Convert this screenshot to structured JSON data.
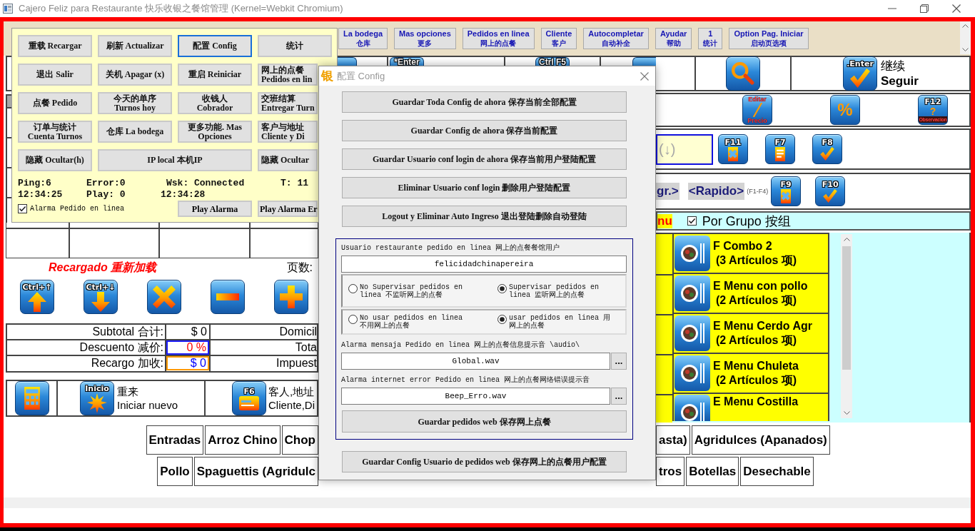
{
  "window": {
    "title": "Cajero Feliz para Restaurante 快乐收银之餐馆管理 (Kernel=Webkit Chromium)"
  },
  "nav_buttons": [
    {
      "label": "La bodega",
      "sublabel": "仓库"
    },
    {
      "label": "Mas opciones",
      "sublabel": "更多"
    },
    {
      "label": "Pedidos en linea",
      "sublabel": "网上的点餐"
    },
    {
      "label": "Cliente",
      "sublabel": "客户"
    },
    {
      "label": "Autocompletar",
      "sublabel": "自动补全"
    },
    {
      "label": "Ayudar",
      "sublabel": "帮助"
    },
    {
      "label": "1",
      "sublabel": "统计"
    },
    {
      "label": "Option Pag. Iniciar",
      "sublabel": "启动页选项"
    }
  ],
  "top_row": {
    "peeks": [
      {
        "kind": "peek"
      },
      {
        "kind": "peek",
        "key": "*Enter"
      },
      {
        "kind": "peek",
        "key": "Ctrl F5"
      },
      {
        "kind": "peek"
      }
    ],
    "search_key": {
      "kind": "search"
    },
    "continue_key": {
      "kind": "check",
      "key": ".Enter",
      "caption": "继续",
      "sub_caption": "Seguir"
    }
  },
  "price_keys": [
    {
      "kind": "edit-price",
      "key": "Editar",
      "footer": "Precio"
    },
    {
      "kind": "percent",
      "glyph": "%"
    },
    {
      "kind": "question",
      "key": "F12",
      "glyph": "?",
      "footer": "Observacion"
    }
  ],
  "search_field": {
    "placeholder": "(↓)"
  },
  "list_keys": [
    {
      "kind": "doc-cross",
      "key": "F11"
    },
    {
      "kind": "doc-list",
      "key": "F7"
    },
    {
      "kind": "check",
      "key": "F8"
    }
  ],
  "mode_buttons": [
    "gr.>",
    "<Rapido>"
  ],
  "mode_hint": "(F1-F4)",
  "confirm_keys": [
    {
      "kind": "doc-cross",
      "key": "F9"
    },
    {
      "kind": "check",
      "key": "F10"
    }
  ],
  "menu_bar": {
    "tab": "nu",
    "group_checkbox": {
      "label": "Por Grupo 按组",
      "checked": true
    }
  },
  "menu_items": [
    {
      "name": "F Combo 2",
      "detail": "(3 Artículos 项)"
    },
    {
      "name": "E Menu con pollo",
      "detail": "(2 Artículos 项)"
    },
    {
      "name": "E Menu Cerdo Agr",
      "detail": "(2 Artículos 项)"
    },
    {
      "name": "E Menu Chuleta",
      "detail": "(2 Artículos 项)"
    },
    {
      "name": "E Menu Costilla"
    }
  ],
  "order_panel": {
    "status": "Recargado 重新加载",
    "page_label": "页数:",
    "keys": [
      {
        "kind": "arrow-up",
        "key": "Ctrl+↑"
      },
      {
        "kind": "arrow-down",
        "key": "Ctrl+↓"
      },
      {
        "kind": "cross"
      },
      {
        "kind": "minus"
      },
      {
        "kind": "plus"
      }
    ],
    "totals": [
      {
        "kind": "plain",
        "label": "Subtotal 合计:",
        "value": "$ 0",
        "side_label": "Domicil"
      },
      {
        "kind": "discount",
        "label": "Descuento 减价:",
        "value": "0 %",
        "side_label": "Tota"
      },
      {
        "kind": "surcharge",
        "label": "Recargo 加收:",
        "value": "$ 0",
        "side_label": "Impuest"
      }
    ],
    "actions": [
      {
        "kind": "calculator"
      },
      {
        "kind": "burst",
        "key": "Inicio",
        "caption": "重来",
        "sub_caption": "Iniciar nuevo"
      },
      {
        "kind": "card",
        "key": "F6",
        "caption": "客人,地址",
        "sub_caption": "Cliente,Di"
      }
    ]
  },
  "categories": [
    {
      "left": [
        "Entradas",
        "Arroz Chino",
        "Chop"
      ],
      "right": [
        "asta)",
        "Agridulces (Apanados)"
      ]
    },
    {
      "left": [
        "Pollo",
        "Spaguettis (Agridulc"
      ],
      "right": [
        "tros",
        "Botellas",
        "Desechable"
      ]
    }
  ],
  "quick_menu": {
    "rows": [
      [
        {
          "kind": "normal",
          "label": "重载 Recargar",
          "focused": false
        },
        {
          "kind": "normal",
          "label": "刷新 Actualizar",
          "focused": false
        },
        {
          "kind": "normal",
          "label": "配置 Config",
          "focused": true
        },
        {
          "kind": "normal",
          "label": "统计",
          "focused": false
        }
      ],
      [
        {
          "kind": "normal",
          "label": "退出 Salir",
          "focused": false
        },
        {
          "kind": "normal",
          "label": "关机 Apagar (x)",
          "focused": false
        },
        {
          "kind": "normal",
          "label": "重启 Reiniciar",
          "focused": false
        },
        {
          "kind": "normal",
          "label": "网上的点餐",
          "sublabel": "Pedidos en lin",
          "focused": false
        }
      ],
      [
        {
          "kind": "normal",
          "label": "点餐 Pedido",
          "focused": false
        },
        {
          "kind": "normal",
          "label": "今天的单序",
          "sublabel": "Turnos hoy",
          "focused": false
        },
        {
          "kind": "normal",
          "label": "收钱人",
          "sublabel": "Cobrador",
          "focused": false
        },
        {
          "kind": "normal",
          "label": "交班结算",
          "sublabel": "Entregar Turn",
          "focused": false
        }
      ],
      [
        {
          "kind": "normal",
          "label": "订单与统计",
          "sublabel": "Cuenta Turnos",
          "focused": false
        },
        {
          "kind": "normal",
          "label": "仓库 La bodega",
          "focused": false
        },
        {
          "kind": "normal",
          "label": "更多功能. Mas",
          "sublabel": "Opciones",
          "focused": false
        },
        {
          "kind": "normal",
          "label": "客户与地址",
          "sublabel": "Cliente y Di",
          "focused": false
        }
      ],
      [
        {
          "kind": "normal",
          "label": "隐藏 Ocultar(h)",
          "focused": false
        },
        {
          "kind": "wide",
          "label": "IP local 本机IP",
          "focused": false
        },
        "",
        {
          "kind": "normal",
          "label": "隐藏 Ocultar",
          "focused": false
        }
      ]
    ],
    "status_lines": [
      [
        "Ping:6",
        "Error:0",
        "Wsk: Connected",
        "T: 11"
      ],
      [
        "12:34:25",
        "Play: 0",
        "12:34:28"
      ]
    ],
    "alarm_checkbox": {
      "label": "Alarma Pedido en linea",
      "checked": true
    },
    "play_buttons": [
      "Play Alarma",
      "Play Alarma Er"
    ]
  },
  "config_dialog": {
    "logo": "银",
    "title": "配置 Config",
    "buttons": [
      "Guardar Toda Config de ahora 保存当前全部配置",
      "Guardar Config de ahora 保存当前配置",
      "Guardar Usuario conf login de ahora 保存当前用户登陆配置",
      "Eliminar Usuario conf login 删除用户登陆配置",
      "Logout y Eliminar Auto Ingreso 退出登陆删除自动登陆"
    ],
    "web_orders": {
      "user_label": "Usuario restaurante pedido en linea 网上的点餐餐馆用户",
      "user_value": "felicidadchinapereira",
      "radio_groups": [
        [
          {
            "label": "No Supervisar pedidos en linea 不监听网上的点餐",
            "selected": false
          },
          {
            "label": "Supervisar pedidos en linea 监听网上的点餐",
            "selected": true
          }
        ],
        [
          {
            "label": "No usar pedidos en linea 不用网上的点餐",
            "selected": false
          },
          {
            "label": "usar pedidos en linea 用网上的点餐",
            "selected": true
          }
        ]
      ],
      "sound_fields": [
        {
          "label": "Alarma mensaja Pedido en linea 网上的点餐信息提示音 \\audio\\",
          "value": "Global.wav",
          "browse": "..."
        },
        {
          "label": "Alarma internet error Pedido en linea 网上的点餐网络错误提示音",
          "value": "Beep_Erro.wav",
          "browse": "..."
        }
      ],
      "save_button": "Guardar pedidos web 保存网上点餐"
    },
    "footer_button": "Guardar Config Usuario de pedidos web 保存网上的点餐用户配置"
  }
}
